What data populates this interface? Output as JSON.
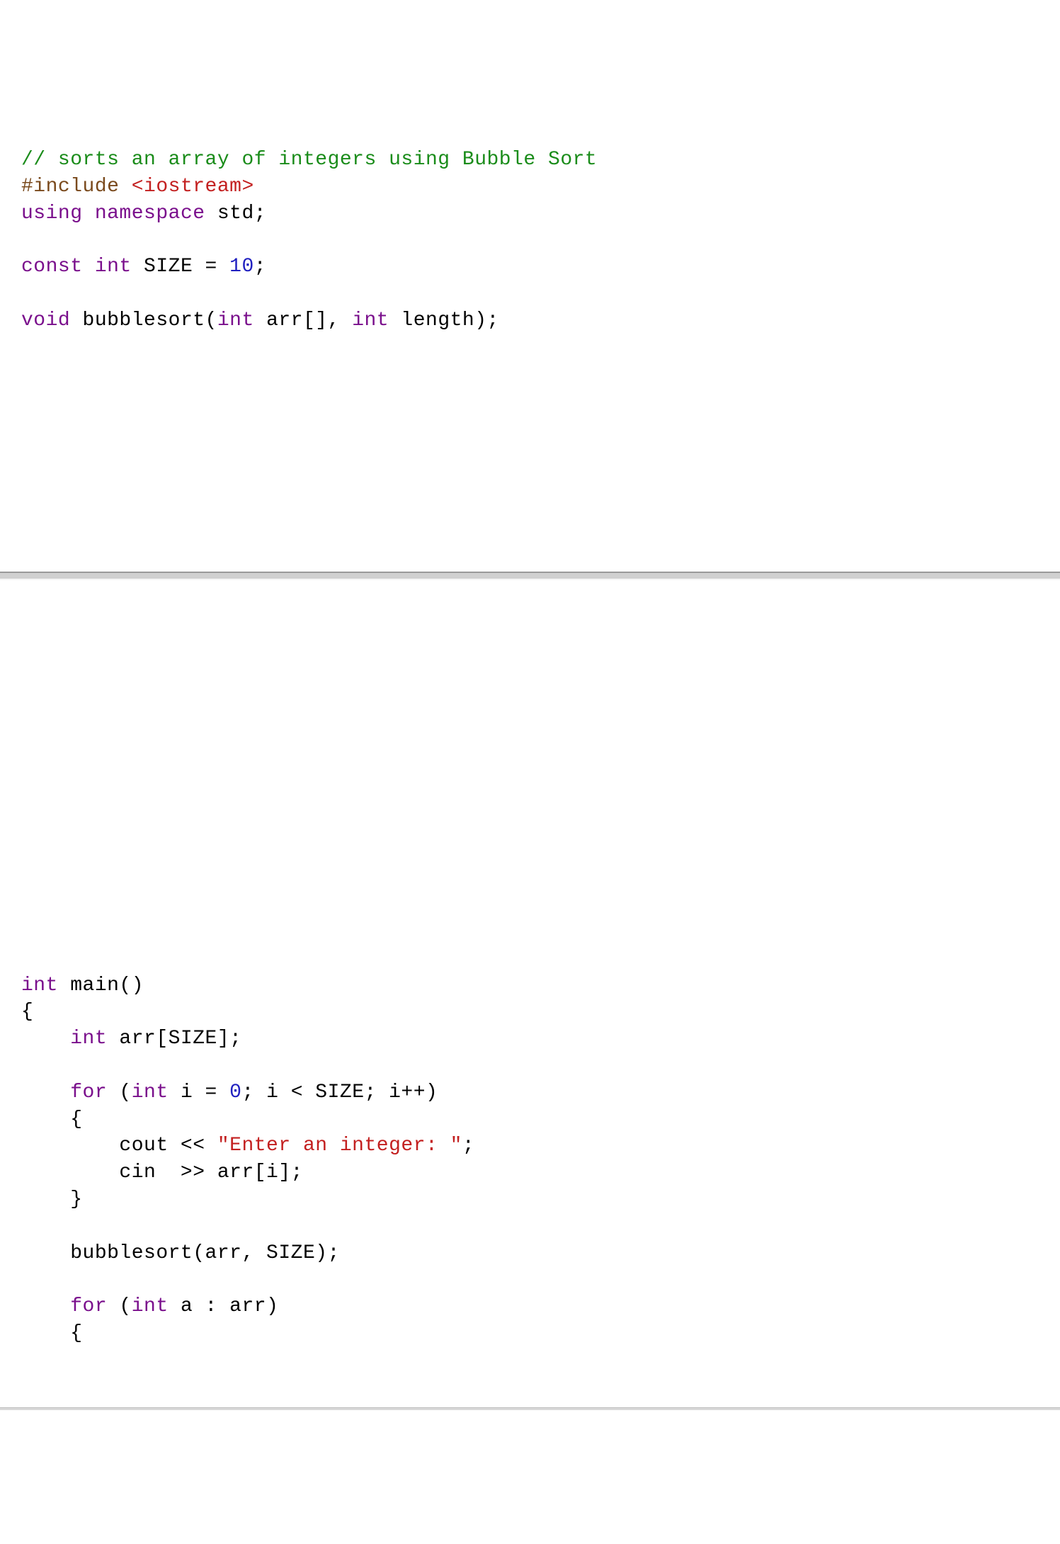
{
  "top": {
    "l1_comment": "// sorts an array of integers using Bubble Sort",
    "l2_include_kw": "#include ",
    "l2_include_val": "<iostream>",
    "l3_using": "using ",
    "l3_namespace": "namespace ",
    "l3_std": "std;",
    "l5_const": "const ",
    "l5_int": "int ",
    "l5_size": "SIZE = ",
    "l5_ten": "10",
    "l5_semi": ";",
    "l7_void": "void ",
    "l7_fn": "bubblesort(",
    "l7_int": "int ",
    "l7_arr": "arr[], ",
    "l7_int2": "int ",
    "l7_length": "length);"
  },
  "bot": {
    "m1_int": "int ",
    "m1_main": "main()",
    "m2_lb": "{",
    "m3_int": "    int ",
    "m3_arr": "arr[SIZE];",
    "m5_for": "    for ",
    "m5_lp": "(",
    "m5_int": "int ",
    "m5_iexp_a": "i = ",
    "m5_zero": "0",
    "m5_iexp_b": "; i < SIZE; i++)",
    "m6_lb": "    {",
    "m7_cout1": "        cout << ",
    "m7_str": "\"Enter an integer: \"",
    "m7_cout2": ";",
    "m8_cin": "        cin  >> arr[i];",
    "m9_rb": "    }",
    "m11_call": "    bubblesort(arr, SIZE);",
    "m13_for": "    for ",
    "m13_lp": "(",
    "m13_int": "int ",
    "m13_a": "a : arr)",
    "m14_lb": "    {"
  }
}
